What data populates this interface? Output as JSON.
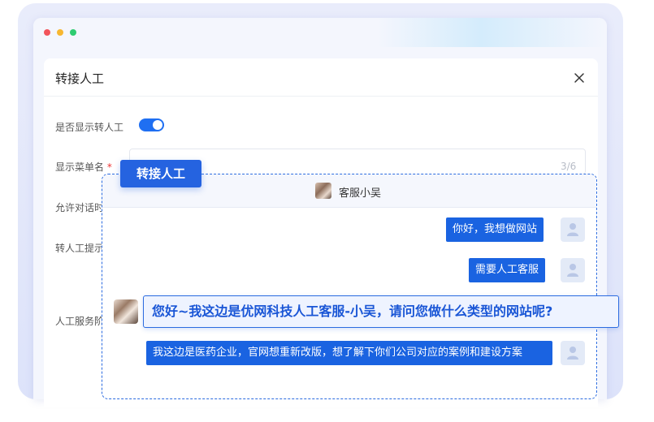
{
  "dialog": {
    "title": "转接人工"
  },
  "form": {
    "show_transfer_label": "是否显示转人工",
    "menu_name_label": "显示菜单名",
    "required_mark": "*",
    "counter": "3/6",
    "allow_dialog_label": "允许对话时",
    "transfer_prompt_label": "转人工提示",
    "service_label": "人工服务阶"
  },
  "tag": {
    "label": "转接人工"
  },
  "chat": {
    "agent_name": "客服小吴",
    "messages": [
      {
        "from": "user",
        "text": "你好，我想做网站"
      },
      {
        "from": "user",
        "text": "需要人工客服"
      },
      {
        "from": "agent",
        "text": "您好~我这边是优网科技人工客服-小吴，请问您做什么类型的网站呢?"
      },
      {
        "from": "user",
        "text": "我这边是医药企业，官网想重新改版，想了解下你们公司对应的案例和建设方案"
      }
    ]
  },
  "colors": {
    "primary": "#1a63e1",
    "accent_border": "#2b6be0",
    "toggle_on": "#1f6ff2"
  },
  "icons": {
    "close": "close-icon",
    "user": "user-icon"
  }
}
